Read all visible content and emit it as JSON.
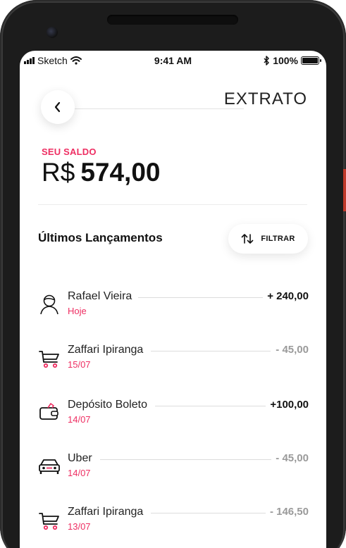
{
  "status_bar": {
    "carrier": "Sketch",
    "time": "9:41 AM",
    "battery": "100%",
    "icons": [
      "signal-bars-icon",
      "wifi-icon",
      "bluetooth-icon",
      "battery-icon"
    ]
  },
  "header": {
    "back_icon": "chevron-left-icon",
    "title": "EXTRATO"
  },
  "balance": {
    "label": "SEU SALDO",
    "currency": "R$",
    "value": "574,00"
  },
  "section": {
    "title": "Últimos Lançamentos",
    "filter_label": "FILTRAR",
    "filter_icon": "sort-arrows-icon"
  },
  "transactions": [
    {
      "name": "Rafael Vieira",
      "date": "Hoje",
      "amount": "+ 240,00",
      "type": "positive",
      "icon": "person-icon"
    },
    {
      "name": "Zaffari Ipiranga",
      "date": "15/07",
      "amount": "- 45,00",
      "type": "negative",
      "icon": "cart-icon"
    },
    {
      "name": "Depósito Boleto",
      "date": "14/07",
      "amount": "+100,00",
      "type": "positive",
      "icon": "wallet-icon"
    },
    {
      "name": "Uber",
      "date": "14/07",
      "amount": "- 45,00",
      "type": "negative",
      "icon": "car-icon"
    },
    {
      "name": "Zaffari Ipiranga",
      "date": "13/07",
      "amount": "- 146,50",
      "type": "negative",
      "icon": "cart-icon"
    }
  ],
  "colors": {
    "accent": "#ee2e62",
    "text": "#111111",
    "muted": "#9a9a9a",
    "device": "#1c1c1c"
  }
}
